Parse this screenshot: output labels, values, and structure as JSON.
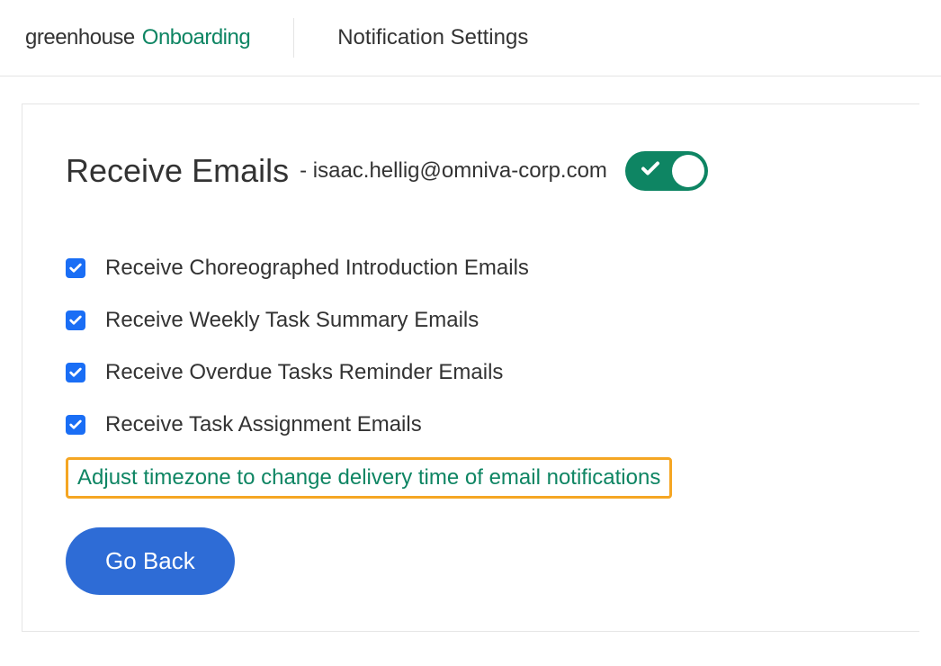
{
  "header": {
    "logo_main": "greenhouse",
    "logo_sub": "Onboarding",
    "title": "Notification Settings"
  },
  "section": {
    "title": "Receive Emails",
    "email_prefix": "- ",
    "email": "isaac.hellig@omniva-corp.com",
    "toggle_on": true
  },
  "checkboxes": [
    {
      "label": "Receive Choreographed Introduction Emails",
      "checked": true
    },
    {
      "label": "Receive Weekly Task Summary Emails",
      "checked": true
    },
    {
      "label": "Receive Overdue Tasks Reminder Emails",
      "checked": true
    },
    {
      "label": "Receive Task Assignment Emails",
      "checked": true
    }
  ],
  "timezone_link": "Adjust timezone to change delivery time of email notifications",
  "go_back_label": "Go Back"
}
